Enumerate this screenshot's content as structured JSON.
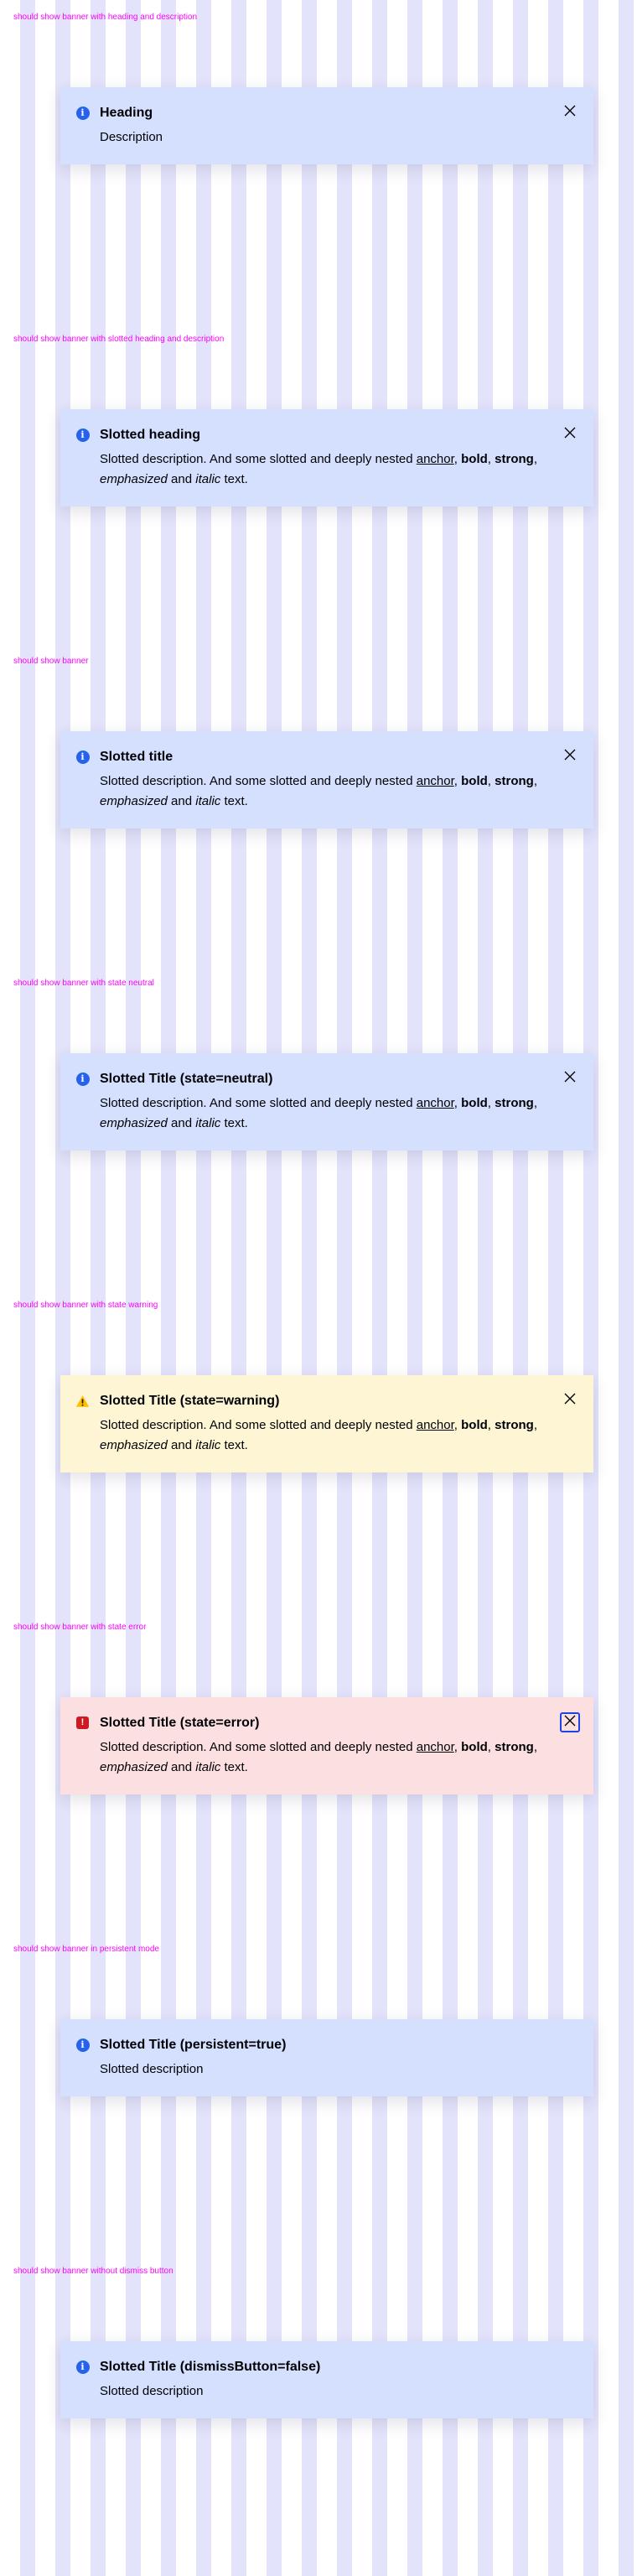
{
  "sections": [
    {
      "label": "should show banner with heading and description",
      "state": "neutral",
      "title": "Heading",
      "description": "Description",
      "rich": false,
      "dismiss": true,
      "dismiss_focused": false
    },
    {
      "label": "should show banner with slotted heading and description",
      "state": "neutral",
      "title": "Slotted heading",
      "rich": true,
      "dismiss": true,
      "dismiss_focused": false
    },
    {
      "label": "should show banner",
      "state": "neutral",
      "title": "Slotted title",
      "rich": true,
      "dismiss": true,
      "dismiss_focused": false
    },
    {
      "label": "should show banner with state neutral",
      "state": "neutral",
      "title": "Slotted Title (state=neutral)",
      "rich": true,
      "dismiss": true,
      "dismiss_focused": false
    },
    {
      "label": "should show banner with state warning",
      "state": "warning",
      "title": "Slotted Title (state=warning)",
      "rich": true,
      "dismiss": true,
      "dismiss_focused": false
    },
    {
      "label": "should show banner with state error",
      "state": "error",
      "title": "Slotted Title (state=error)",
      "rich": true,
      "dismiss": true,
      "dismiss_focused": true
    },
    {
      "label": "should show banner in persistent mode",
      "state": "neutral",
      "title": "Slotted Title (persistent=true)",
      "description": "Slotted description",
      "rich": false,
      "dismiss": false,
      "dismiss_focused": false
    },
    {
      "label": "should show banner without dismiss button",
      "state": "neutral",
      "title": "Slotted Title (dismissButton=false)",
      "description": "Slotted description",
      "rich": false,
      "dismiss": false,
      "dismiss_focused": false
    }
  ],
  "rich_description": {
    "intro": "Slotted description. And some slotted and deeply nested ",
    "anchor": "anchor",
    "sep1": ", ",
    "bold": "bold",
    "sep2": ", ",
    "strong": "strong",
    "sep3": ", ",
    "emphasized": "emphasized",
    "and": " and ",
    "italic": "italic",
    "outro": " text."
  },
  "colors": {
    "label": "#ff00ff",
    "neutral_bg": "#d4e0fd",
    "warning_bg": "#fdf5d3",
    "error_bg": "#fcdfe0",
    "info_icon": "#2762ec",
    "warning_icon": "#ffbe00",
    "error_icon": "#cc1922",
    "focus": "#1a44ea"
  },
  "icons": {
    "neutral": "information-icon",
    "warning": "exclamation-triangle-icon",
    "error": "exclamation-square-icon",
    "close": "close-icon"
  }
}
